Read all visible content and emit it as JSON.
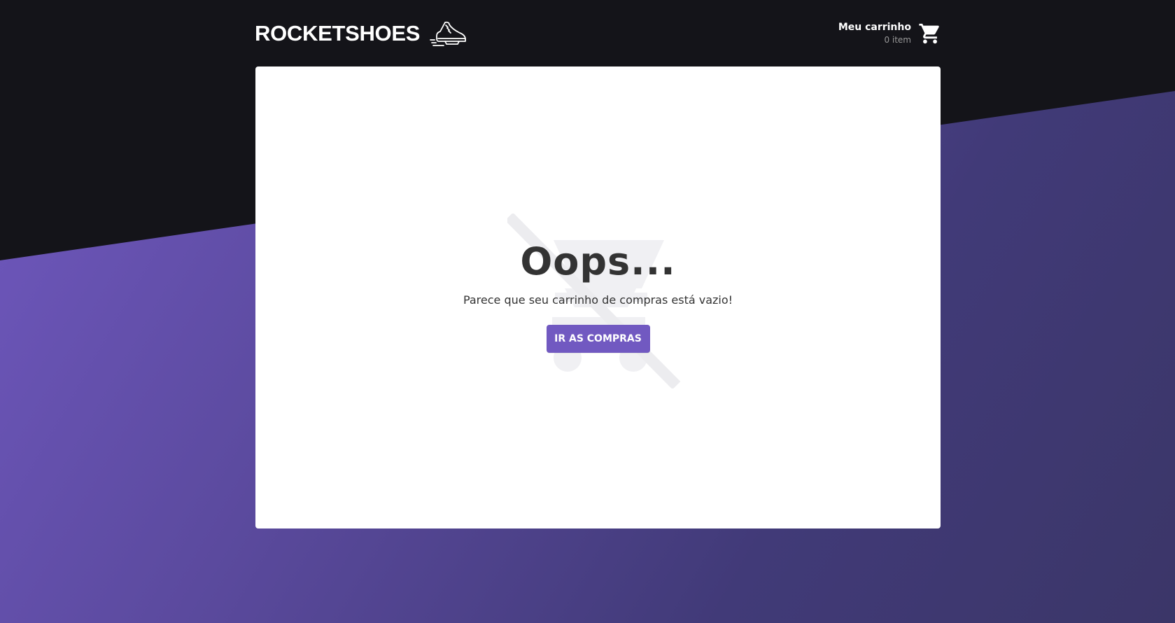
{
  "header": {
    "brand": "ROCKETSHOES",
    "cart_title": "Meu carrinho",
    "cart_count": "0 item"
  },
  "empty_cart": {
    "title": "Oops...",
    "message": "Parece que seu carrinho de compras está vazio!",
    "button_label": "IR AS COMPRAS"
  },
  "colors": {
    "accent": "#7159c1",
    "dark_background": "#141419",
    "text": "#333333"
  },
  "icons": {
    "brand": "shoe-icon",
    "cart": "shopping-cart-icon",
    "empty_state": "cart-off-icon"
  }
}
